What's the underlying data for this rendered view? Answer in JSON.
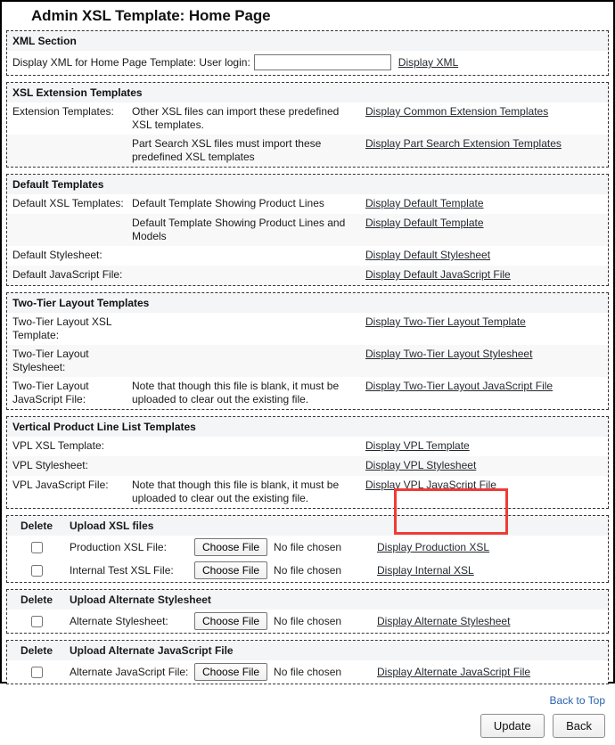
{
  "page": {
    "title": "Admin XSL Template: Home Page"
  },
  "xml_section": {
    "header": "XML Section",
    "label": "Display XML for Home Page Template: User login:",
    "input_value": "",
    "input_placeholder": "",
    "link": "Display XML"
  },
  "extension_section": {
    "header": "XSL Extension Templates",
    "rows": [
      {
        "label": "Extension Templates:",
        "desc": "Other XSL files can import these predefined XSL templates.",
        "link": "Display Common Extension Templates"
      },
      {
        "label": "",
        "desc": "Part Search XSL files must import these predefined XSL templates",
        "link": "Display Part Search Extension Templates"
      }
    ]
  },
  "default_section": {
    "header": "Default Templates",
    "rows": [
      {
        "label": "Default XSL Templates:",
        "desc": "Default Template Showing Product Lines",
        "link": "Display Default Template"
      },
      {
        "label": "",
        "desc": "Default Template Showing Product Lines and Models",
        "link": "Display Default Template"
      },
      {
        "label": "Default Stylesheet:",
        "desc": "",
        "link": "Display Default Stylesheet"
      },
      {
        "label": "Default JavaScript File:",
        "desc": "",
        "link": "Display Default JavaScript File"
      }
    ]
  },
  "twotier_section": {
    "header": "Two-Tier Layout Templates",
    "rows": [
      {
        "label": "Two-Tier Layout XSL Template:",
        "desc": "",
        "link": "Display Two-Tier Layout Template"
      },
      {
        "label": "Two-Tier Layout Stylesheet:",
        "desc": "",
        "link": "Display Two-Tier Layout Stylesheet"
      },
      {
        "label": "Two-Tier Layout JavaScript File:",
        "desc": "Note that though this file is blank, it must be uploaded to clear out the existing file.",
        "link": "Display Two-Tier Layout JavaScript File"
      }
    ]
  },
  "vpl_section": {
    "header": "Vertical Product Line List Templates",
    "rows": [
      {
        "label": "VPL XSL Template:",
        "desc": "",
        "link": "Display VPL Template"
      },
      {
        "label": "VPL Stylesheet:",
        "desc": "",
        "link": "Display VPL Stylesheet"
      },
      {
        "label": "VPL JavaScript File:",
        "desc": "Note that though this file is blank, it must be uploaded to clear out the existing file.",
        "link": "Display VPL JavaScript File"
      }
    ]
  },
  "upload_xsl": {
    "delete_header": "Delete",
    "title": "Upload XSL files",
    "rows": [
      {
        "name": "Production XSL File:",
        "button": "Choose File",
        "file_status": "No file chosen",
        "link": "Display Production XSL"
      },
      {
        "name": "Internal Test XSL File:",
        "button": "Choose File",
        "file_status": "No file chosen",
        "link": "Display Internal XSL"
      }
    ]
  },
  "upload_stylesheet": {
    "delete_header": "Delete",
    "title": "Upload Alternate Stylesheet",
    "rows": [
      {
        "name": "Alternate Stylesheet:",
        "button": "Choose File",
        "file_status": "No file chosen",
        "link": "Display Alternate Stylesheet"
      }
    ]
  },
  "upload_javascript": {
    "delete_header": "Delete",
    "title": "Upload Alternate JavaScript File",
    "rows": [
      {
        "name": "Alternate JavaScript File:",
        "button": "Choose File",
        "file_status": "No file chosen",
        "link": "Display Alternate JavaScript File"
      }
    ]
  },
  "footer": {
    "back_to_top": "Back to Top",
    "update_button": "Update",
    "back_button": "Back"
  },
  "highlight": {
    "color": "#f03b36"
  }
}
